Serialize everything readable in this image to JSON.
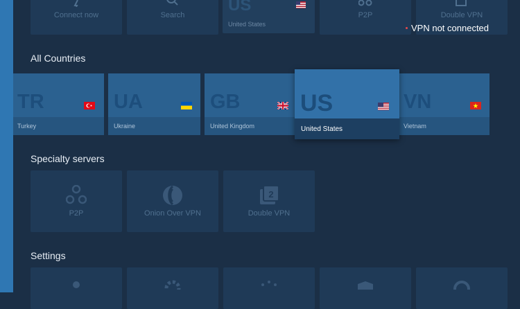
{
  "top_row": {
    "connect_now": "Connect now",
    "search": "Search",
    "recent_code": "US",
    "recent_name": "United States",
    "p2p": "P2P",
    "double_vpn": "Double VPN"
  },
  "status": {
    "text": "VPN not connected"
  },
  "all_countries": {
    "title": "All Countries",
    "items": [
      {
        "code": "TR",
        "name": "Turkey",
        "flag": "turkey-flag"
      },
      {
        "code": "UA",
        "name": "Ukraine",
        "flag": "ukraine-flag"
      },
      {
        "code": "GB",
        "name": "United Kingdom",
        "flag": "uk-flag"
      },
      {
        "code": "US",
        "name": "United States",
        "flag": "us-flag",
        "selected": true
      },
      {
        "code": "VN",
        "name": "Vietnam",
        "flag": "vietnam-flag"
      }
    ]
  },
  "specialty": {
    "title": "Specialty servers",
    "items": [
      {
        "label": "P2P",
        "icon": "p2p-icon"
      },
      {
        "label": "Onion Over VPN",
        "icon": "onion-icon"
      },
      {
        "label": "Double VPN",
        "icon": "double-vpn-icon"
      }
    ]
  },
  "settings": {
    "title": "Settings"
  },
  "colors": {
    "accent": "#2f77b3",
    "status_dot": "#e6494c",
    "background": "#1b2f46"
  }
}
